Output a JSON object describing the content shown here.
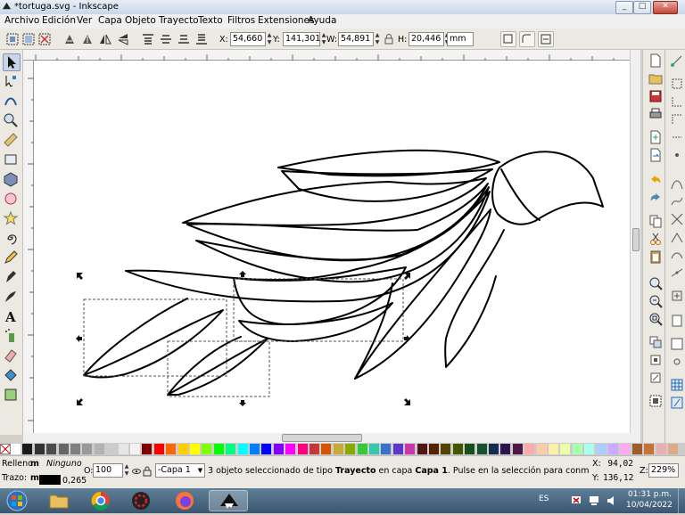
{
  "window": {
    "title": "*tortuga.svg - Inkscape",
    "min": "_",
    "max": "□",
    "close": "✕"
  },
  "menu": [
    "Archivo",
    "Edición",
    "Ver",
    "Capa",
    "Objeto",
    "Trayecto",
    "Texto",
    "Filtros",
    "Extensiones",
    "Ayuda"
  ],
  "toolbar": {
    "x_label": "X:",
    "x_value": "54,660",
    "y_label": "Y:",
    "y_value": "141,301",
    "w_label": "W:",
    "w_value": "54,891",
    "h_label": "H:",
    "h_value": "20,446",
    "unit": "mm"
  },
  "status": {
    "fill_label": "Relleno:",
    "fill_mode": "m",
    "fill_value": "Ninguno",
    "stroke_label": "Trazo:",
    "stroke_mode": "m",
    "stroke_width": "0,265",
    "opacity_label": "O:",
    "opacity_value": "100",
    "layer": "-Capa 1",
    "message_pre": "3 objeto seleccionado de tipo ",
    "message_type": "Trayecto",
    "message_mid": " en capa ",
    "message_layer": "Capa 1",
    "message_post": ". Pulse en la selección para conmutar los tiradores d...",
    "cx_label": "X:",
    "cx_value": "94,02",
    "cy_label": "Y:",
    "cy_value": "136,12",
    "zoom_label": "Z:",
    "zoom_value": "229%"
  },
  "taskbar": {
    "lang": "ES",
    "time": "01:31 p.m.",
    "date": "10/04/2022"
  },
  "palette_colors": [
    "#ffffff",
    "#1a1a1a",
    "#333333",
    "#4d4d4d",
    "#666666",
    "#808080",
    "#999999",
    "#b3b3b3",
    "#cccccc",
    "#e6e6e6",
    "#f2f2f2",
    "#800000",
    "#ff0000",
    "#ff6600",
    "#ffcc00",
    "#ffff00",
    "#80ff00",
    "#00ff00",
    "#00ff80",
    "#00ffff",
    "#0080ff",
    "#0000ff",
    "#8000ff",
    "#ff00ff",
    "#ff0080",
    "#c83737",
    "#d45500",
    "#c8ab37",
    "#88aa00",
    "#37c837",
    "#37c8ab",
    "#3771c8",
    "#5f37c8",
    "#c837ab",
    "#501616",
    "#552200",
    "#554400",
    "#445500",
    "#165016",
    "#16502d",
    "#162d50",
    "#2d1650",
    "#501644",
    "#ffaaaa",
    "#ffccaa",
    "#ffeeaa",
    "#eeffaa",
    "#aaffaa",
    "#aaffee",
    "#aaccff",
    "#ccaaff",
    "#ffaaee",
    "#a05a2c",
    "#c87137",
    "#e9afaf",
    "#deaa87"
  ]
}
